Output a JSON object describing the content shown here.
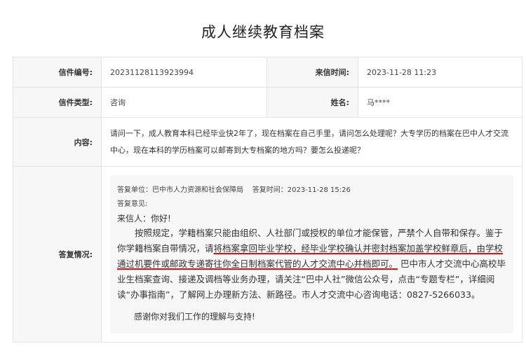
{
  "page": {
    "title": "成人继续教育档案"
  },
  "info": {
    "letter_no_label": "信件编号:",
    "letter_no": "20231128113923994",
    "received_label": "来信时间:",
    "received_time": "2023-11-28 11:23",
    "type_label": "信件类型:",
    "type": "咨询",
    "name_label": "姓名:",
    "name": "马****",
    "content_label": "内容:",
    "content": "请问一下，成人教育本科已经毕业快2年了，现在档案在自己手里，请问怎么处理呢？大专学历的档案在巴中人才交流中心，现在本科的学历档案可以邮寄到大专档案的地方吗？要怎么投递呢？",
    "reply_label": "答复情况:"
  },
  "reply": {
    "unit_line": "答复单位：巴中市人力资源和社会保障局    答复时间：2023-11-28 15:26",
    "opinion_label": "答复意见:",
    "salutation": "来信人：你好!",
    "body_part1": "按照规定，学籍档案只能由组织、人社部门或授权的单位才能保管，严禁个人自带和保存。鉴于你学籍档案自带情况，请",
    "body_ul1": "将档案拿回毕业学校，经毕业学校确认并密封档案加盖学校鲜章后，由学校通过机要件或邮政专递寄往你全日制档案代管的人才交流中心并档即可。",
    "body_part2": " 巴中市人才交流中心高校毕业生档案查询、接递及调档等业务办理，请关注“巴中人社”微信公众号，点击“专题专栏”，详细阅读“办事指南”，了解网上办理新方法、新路径。市人才交流中心咨询电话：0827-5266033。",
    "thanks": "感谢你对我们工作的理解与支持!"
  },
  "colors": {
    "underline": "#e01010",
    "label_bg": "#f7f7f7",
    "border": "#e3e3e3"
  }
}
